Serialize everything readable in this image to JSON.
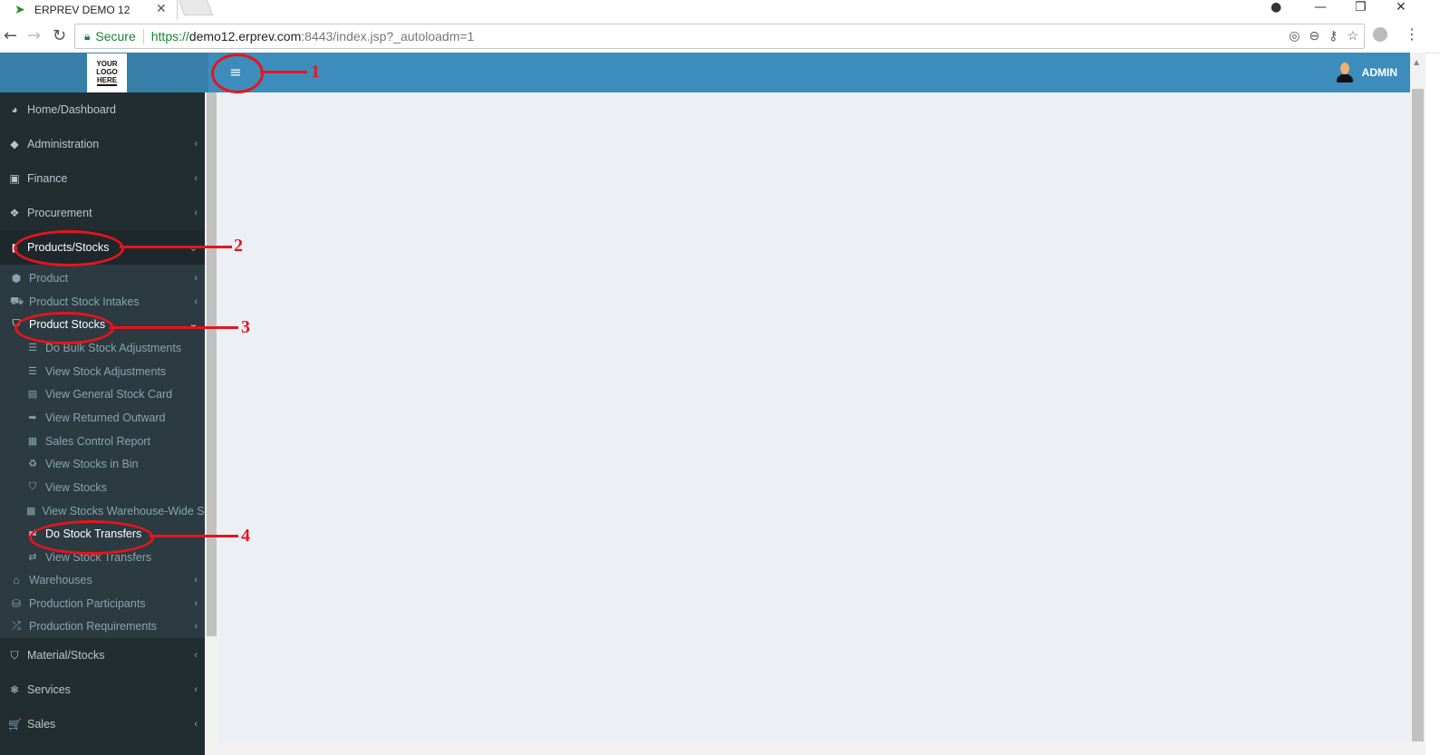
{
  "browser": {
    "tab_title": "ERPREV DEMO 12",
    "secure_label": "Secure",
    "url_proto": "https://",
    "url_host": "demo12.erprev.com",
    "url_rest": ":8443/index.jsp?_autoloadm=1"
  },
  "header": {
    "logo_lines": [
      "YOUR",
      "LOGO",
      "HERE"
    ],
    "menu_toggle_icon": "≡",
    "user_name": "ADMIN"
  },
  "sidebar": {
    "items": [
      {
        "label": "Home/Dashboard",
        "icon": "dashboard-icon",
        "glyph": "◕"
      },
      {
        "label": "Administration",
        "icon": "tag-icon",
        "glyph": "◆"
      },
      {
        "label": "Finance",
        "icon": "money-icon",
        "glyph": "▣"
      },
      {
        "label": "Procurement",
        "icon": "cubes-icon",
        "glyph": "❖"
      },
      {
        "label": "Products/Stocks",
        "icon": "book-icon",
        "glyph": "▮"
      },
      {
        "label": "Material/Stocks",
        "icon": "bucket-icon",
        "glyph": "⛉"
      },
      {
        "label": "Services",
        "icon": "snowflake-icon",
        "glyph": "❄"
      },
      {
        "label": "Sales",
        "icon": "cart-icon",
        "glyph": "🛒"
      }
    ],
    "products_submenu": [
      {
        "label": "Product",
        "glyph": "⬢"
      },
      {
        "label": "Product Stock Intakes",
        "glyph": "⛟"
      },
      {
        "label": "Product Stocks",
        "glyph": "⛉"
      },
      {
        "label": "Warehouses",
        "glyph": "⌂"
      },
      {
        "label": "Production Participants",
        "glyph": "⛁"
      },
      {
        "label": "Production Requirements",
        "glyph": "⤮"
      }
    ],
    "product_stocks_submenu": [
      {
        "label": "Do Bulk Stock Adjustments",
        "glyph": "☰"
      },
      {
        "label": "View Stock Adjustments",
        "glyph": "☰"
      },
      {
        "label": "View General Stock Card",
        "glyph": "▤"
      },
      {
        "label": "View Returned Outward",
        "glyph": "➥"
      },
      {
        "label": "Sales Control Report",
        "glyph": "▦"
      },
      {
        "label": "View Stocks in Bin",
        "glyph": "♻"
      },
      {
        "label": "View Stocks",
        "glyph": "⛉"
      },
      {
        "label": "View Stocks Warehouse-Wide Sheet",
        "glyph": "▦"
      },
      {
        "label": "Do Stock Transfers",
        "glyph": "⇄"
      },
      {
        "label": "View Stock Transfers",
        "glyph": "⇄"
      }
    ]
  },
  "annotations": [
    "1",
    "2",
    "3",
    "4"
  ],
  "colors": {
    "header": "#3c8dbc",
    "sidebar": "#222d32",
    "content": "#ecf0f5",
    "annotation": "#e8141c"
  }
}
